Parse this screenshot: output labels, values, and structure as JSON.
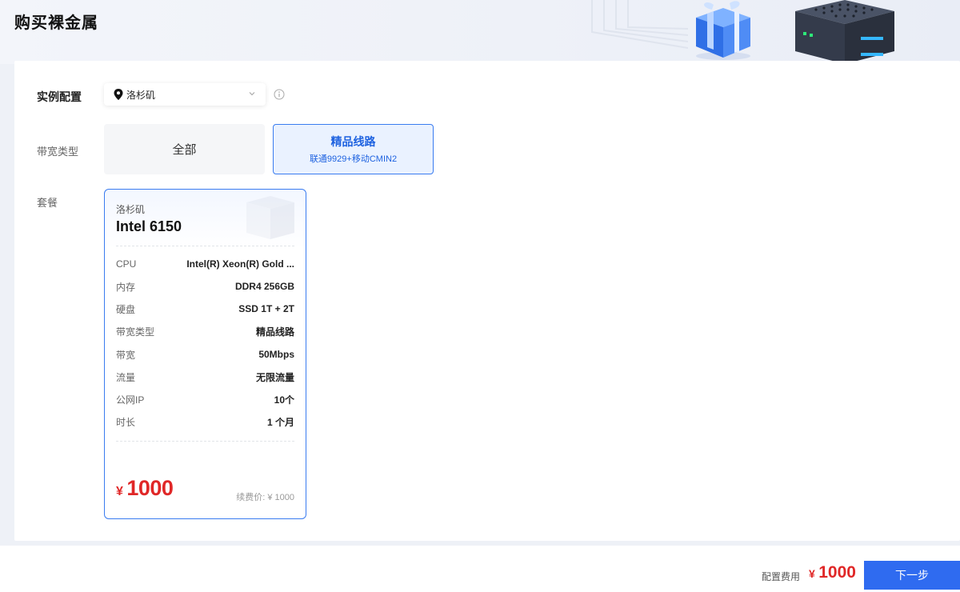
{
  "page": {
    "title": "购买裸金属"
  },
  "config": {
    "instance_label": "实例配置",
    "region_value": "洛杉矶",
    "bandwidth_label": "带宽类型",
    "package_label": "套餐"
  },
  "bandwidth": {
    "options": [
      {
        "label": "全部",
        "sub": ""
      },
      {
        "label": "精品线路",
        "sub": "联通9929+移动CMIN2"
      }
    ],
    "selected": "精品线路"
  },
  "plan": {
    "region": "洛杉矶",
    "name": "Intel 6150",
    "specs": [
      {
        "key": "CPU",
        "value": "Intel(R) Xeon(R) Gold ..."
      },
      {
        "key": "内存",
        "value": "DDR4 256GB"
      },
      {
        "key": "硬盘",
        "value": "SSD 1T + 2T"
      },
      {
        "key": "带宽类型",
        "value": "精品线路"
      },
      {
        "key": "带宽",
        "value": "50Mbps"
      },
      {
        "key": "流量",
        "value": "无限流量"
      },
      {
        "key": "公网IP",
        "value": "10个"
      },
      {
        "key": "时长",
        "value": "1 个月"
      }
    ],
    "price_symbol": "¥",
    "price": "1000",
    "renew_label": "续费价: ¥ 1000"
  },
  "footer": {
    "fee_label": "配置费用",
    "fee_symbol": "¥",
    "fee_value": "1000",
    "next_label": "下一步"
  },
  "colors": {
    "accent": "#2f6bf0",
    "price": "#e02727",
    "selected_bg": "#eaf2ff"
  },
  "icons": [
    "map-pin-icon",
    "chevron-down-icon",
    "info-icon",
    "gift-box-icon",
    "server-icon"
  ]
}
